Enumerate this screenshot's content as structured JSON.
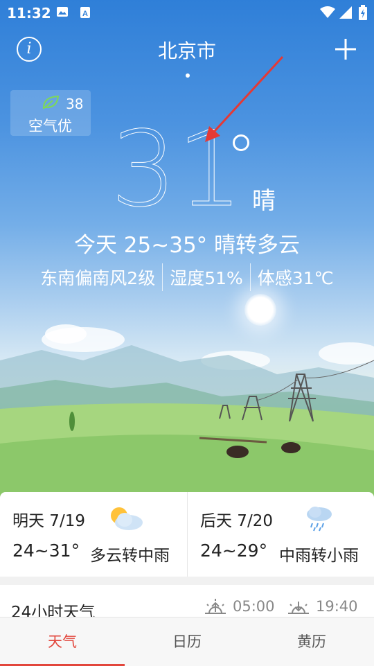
{
  "status_bar": {
    "time": "11:32"
  },
  "header": {
    "city": "北京市"
  },
  "aqi": {
    "value": "38",
    "label": "空气优"
  },
  "current": {
    "temperature": "31",
    "condition": "晴",
    "today_summary": "今天 25~35° 晴转多云",
    "wind": "东南偏南风2级",
    "humidity": "湿度51%",
    "feels_like": "体感31℃"
  },
  "forecast": [
    {
      "day": "明天 7/19",
      "temp": "24~31°",
      "desc": "多云转中雨",
      "icon": "partly-cloudy-icon"
    },
    {
      "day": "后天 7/20",
      "temp": "24~29°",
      "desc": "中雨转小雨",
      "icon": "rain-icon"
    }
  ],
  "hourly": {
    "title": "24小时天气",
    "sunrise": "05:00",
    "sunset": "19:40"
  },
  "tabs": [
    {
      "label": "天气",
      "active": true
    },
    {
      "label": "日历",
      "active": false
    },
    {
      "label": "黄历",
      "active": false
    }
  ],
  "colors": {
    "accent": "#e2463c",
    "sky_top": "#2f7fd8",
    "grass": "#8fcb6c"
  }
}
